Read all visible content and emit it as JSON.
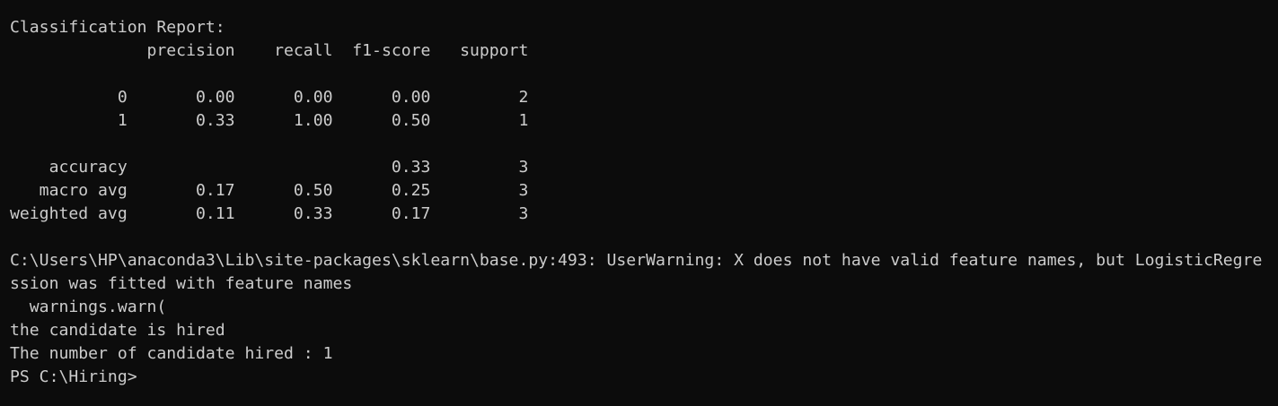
{
  "terminal": {
    "lines": [
      "Classification Report:",
      "              precision    recall  f1-score   support",
      "",
      "           0       0.00      0.00      0.00         2",
      "           1       0.33      1.00      0.50         1",
      "",
      "    accuracy                           0.33         3",
      "   macro avg       0.17      0.50      0.25         3",
      "weighted avg       0.11      0.33      0.17         3",
      "",
      "C:\\Users\\HP\\anaconda3\\Lib\\site-packages\\sklearn\\base.py:493: UserWarning: X does not have valid feature names, but LogisticRegre",
      "ssion was fitted with feature names",
      "  warnings.warn(",
      "the candidate is hired",
      "The number of candidate hired : 1",
      "PS C:\\Hiring>"
    ]
  }
}
